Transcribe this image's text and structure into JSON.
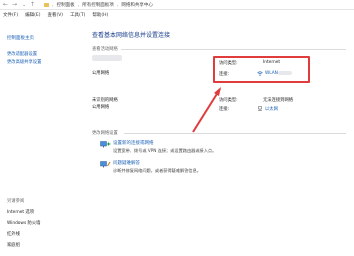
{
  "address_bar": {
    "back": "←",
    "forward": "→",
    "up": "↑",
    "crumbs": [
      "控制面板",
      "所有控制面板项",
      "网络和共享中心"
    ]
  },
  "menu": [
    "文件(F)",
    "编辑(E)",
    "查看(V)",
    "工具(T)",
    "帮助(H)"
  ],
  "sidebar": {
    "home": "控制面板主页",
    "links": [
      "更改适配器设置",
      "更改高级共享设置"
    ],
    "see_also": "另请参阅",
    "bottom_links": [
      "Internet 选项",
      "Windows 防火墙",
      "红外线",
      "家庭组"
    ]
  },
  "main": {
    "title": "查看基本网络信息并设置连接",
    "active_networks_header": "查看活动网络",
    "network1": {
      "type_label": "公用网络",
      "access_label": "访问类型:",
      "access_value": "Internet",
      "connection_label": "连接:",
      "connection_value": "WLAN"
    },
    "network2": {
      "name": "未识别的网络",
      "type_label": "公用网络",
      "access_label": "访问类型:",
      "access_value": "无法连接到网络",
      "connection_label": "连接:",
      "connection_value": "以太网"
    },
    "change_settings_header": "更改网络设置",
    "tasks": [
      {
        "title": "设置新的连接或网络",
        "desc": "设置宽带、拨号或 VPN 连接；或设置路由器或接入点。"
      },
      {
        "title": "问题疑难解答",
        "desc": "诊断并修复网络问题，或者获得疑难解答信息。"
      }
    ]
  },
  "colors": {
    "link": "#1a5fb4",
    "highlight": "#e03c3c",
    "title": "#1a3f8f"
  }
}
